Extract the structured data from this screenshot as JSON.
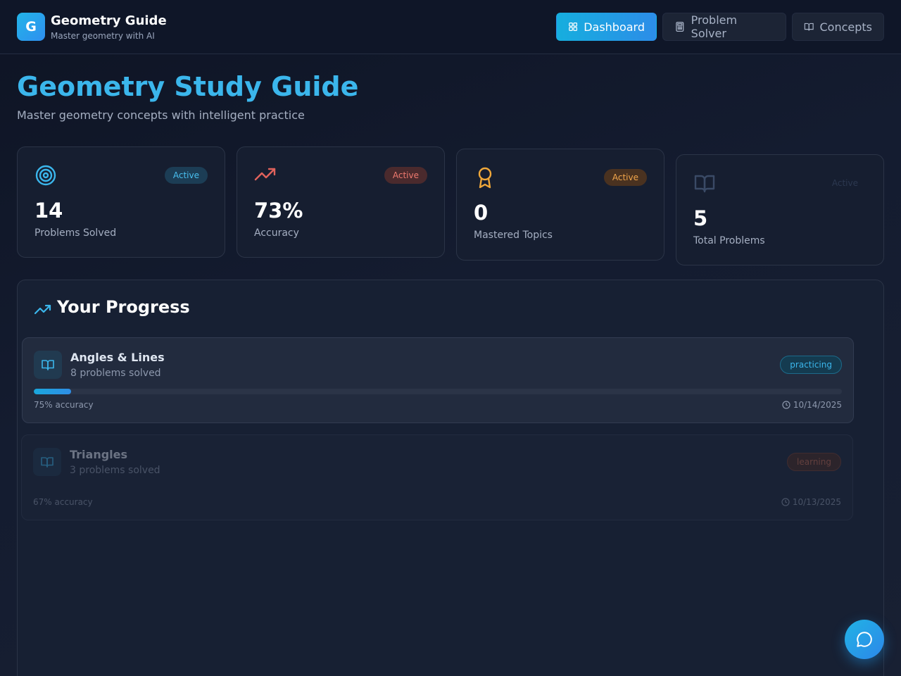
{
  "app": {
    "logo_letter": "G",
    "title": "Geometry Guide",
    "subtitle": "Master geometry with AI"
  },
  "nav": {
    "items": [
      {
        "label": "Dashboard",
        "icon": "grid-icon",
        "active": true
      },
      {
        "label": "Problem Solver",
        "icon": "calculator-icon",
        "active": false
      },
      {
        "label": "Concepts",
        "icon": "book-open-icon",
        "active": false
      }
    ]
  },
  "page": {
    "title": "Geometry Study Guide",
    "subtitle": "Master geometry concepts with intelligent practice"
  },
  "stats": [
    {
      "value": "14",
      "label": "Problems Solved",
      "badge": "Active",
      "icon": "target-icon",
      "accent": "#3bb6ec"
    },
    {
      "value": "73%",
      "label": "Accuracy",
      "badge": "Active",
      "icon": "trending-up-icon",
      "accent": "#e0625c"
    },
    {
      "value": "0",
      "label": "Mastered Topics",
      "badge": "Active",
      "icon": "award-icon",
      "accent": "#f0a83a"
    },
    {
      "value": "5",
      "label": "Total Problems",
      "badge": "Active",
      "icon": "book-open-icon",
      "accent": "#6b7da0"
    }
  ],
  "progress": {
    "title": "Your Progress",
    "topics": [
      {
        "name": "Angles & Lines",
        "count": "8 problems solved",
        "status": "practicing",
        "accuracy": "75% accuracy",
        "date": "10/14/2025",
        "progress": 0.046
      },
      {
        "name": "Triangles",
        "count": "3 problems solved",
        "status": "learning",
        "accuracy": "67% accuracy",
        "date": "10/13/2025",
        "progress": 0
      }
    ]
  },
  "colors": {
    "accent": "#3bb6ec",
    "background": "#0f1628",
    "card": "#161e30"
  }
}
